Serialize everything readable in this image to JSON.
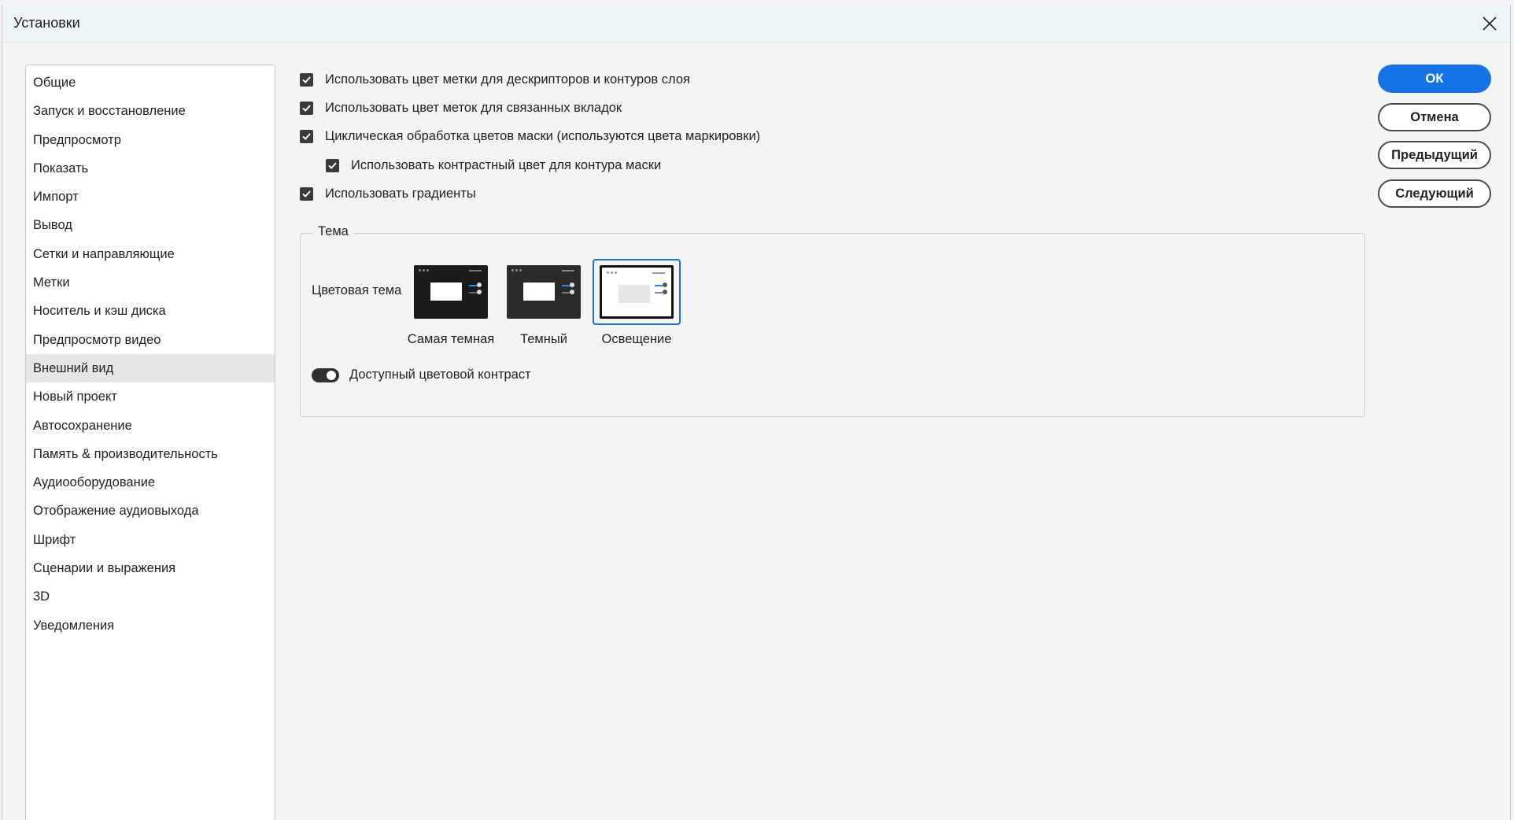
{
  "window": {
    "title": "Установки"
  },
  "sidebar": {
    "items": [
      {
        "label": "Общие"
      },
      {
        "label": "Запуск и восстановление"
      },
      {
        "label": "Предпросмотр"
      },
      {
        "label": "Показать"
      },
      {
        "label": "Импорт"
      },
      {
        "label": "Вывод"
      },
      {
        "label": "Сетки и направляющие"
      },
      {
        "label": "Метки"
      },
      {
        "label": "Носитель и кэш диска"
      },
      {
        "label": "Предпросмотр видео"
      },
      {
        "label": "Внешний вид",
        "selected": true
      },
      {
        "label": "Новый проект"
      },
      {
        "label": "Автосохранение"
      },
      {
        "label": "Память & производительность"
      },
      {
        "label": "Аудиооборудование"
      },
      {
        "label": "Отображение аудиовыхода"
      },
      {
        "label": "Шрифт"
      },
      {
        "label": "Сценарии и выражения"
      },
      {
        "label": "3D"
      },
      {
        "label": "Уведомления"
      }
    ]
  },
  "options": {
    "label_color_layer": {
      "label": "Использовать цвет метки для дескрипторов и контуров слоя",
      "checked": true
    },
    "label_color_tabs": {
      "label": "Использовать цвет меток для связанных вкладок",
      "checked": true
    },
    "cycle_mask_colors": {
      "label": "Циклическая обработка цветов маски (используются цвета маркировки)",
      "checked": true
    },
    "contrast_mask_path": {
      "label": "Использовать контрастный цвет для контура маски",
      "checked": true
    },
    "use_gradients": {
      "label": "Использовать градиенты",
      "checked": true
    }
  },
  "theme": {
    "group_title": "Тема",
    "color_theme_label": "Цветовая тема",
    "themes": [
      {
        "label": "Самая темная",
        "bg": "#1b1b1b"
      },
      {
        "label": "Темный",
        "bg": "#2b2b2b"
      },
      {
        "label": "Освещение",
        "bg": "#ffffff",
        "selected": true
      }
    ],
    "contrast_toggle": {
      "label": "Доступный цветовой контраст",
      "on": true
    }
  },
  "buttons": {
    "ok": "ОК",
    "cancel": "Отмена",
    "previous": "Предыдущий",
    "next": "Следующий"
  },
  "colors": {
    "accent": "#1473e6"
  }
}
